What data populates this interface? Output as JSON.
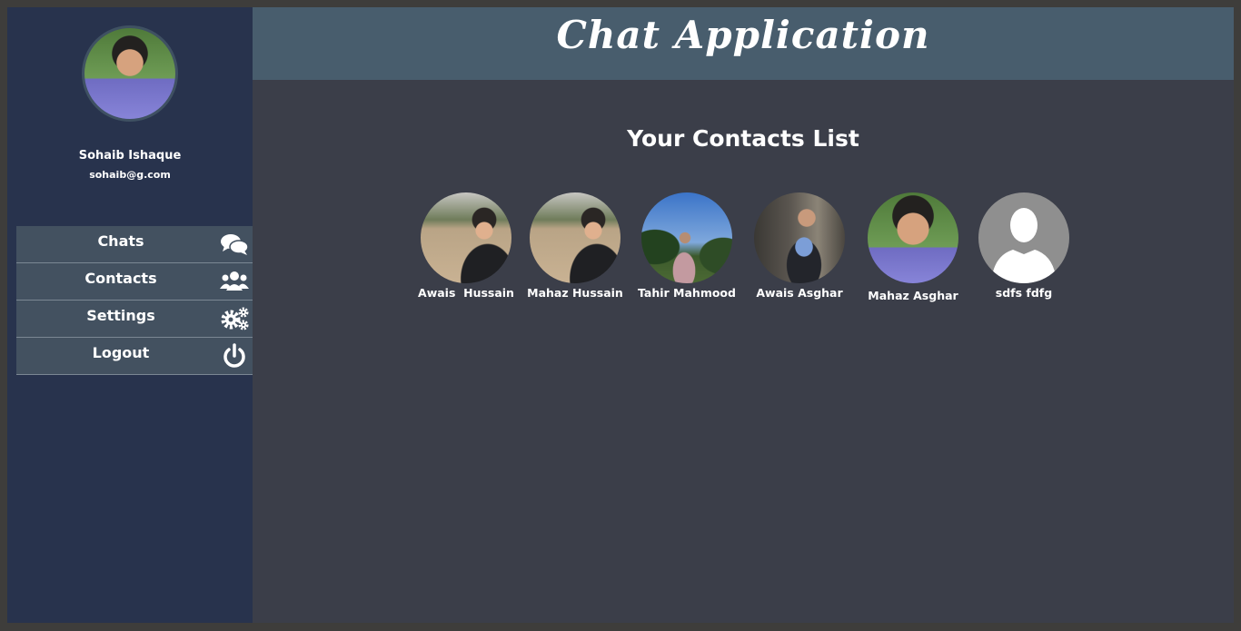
{
  "app": {
    "title": "Chat Application"
  },
  "user": {
    "name": "Sohaib Ishaque",
    "email": "sohaib@g.com"
  },
  "menu": {
    "items": [
      {
        "label": "Chats",
        "icon": "chats-icon"
      },
      {
        "label": "Contacts",
        "icon": "users-icon"
      },
      {
        "label": "Settings",
        "icon": "gears-icon"
      },
      {
        "label": "Logout",
        "icon": "power-icon"
      }
    ]
  },
  "contacts": {
    "title": "Your Contacts List",
    "items": [
      {
        "name": "Awais  Hussain"
      },
      {
        "name": "Mahaz Hussain"
      },
      {
        "name": "Tahir Mahmood"
      },
      {
        "name": "Awais Asghar"
      },
      {
        "name": "Mahaz Asghar"
      },
      {
        "name": "sdfs fdfg"
      }
    ]
  },
  "colors": {
    "sidebar": "#28334d",
    "header": "#485d6d",
    "main": "#3b3e49",
    "menu_item": "#435160"
  }
}
